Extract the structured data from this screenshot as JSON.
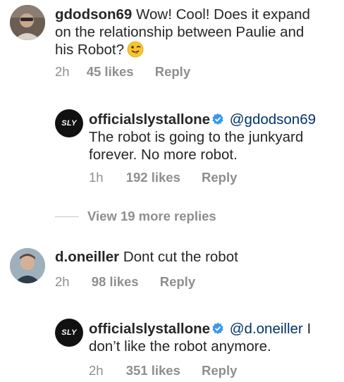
{
  "comments": [
    {
      "username": "gdodson69",
      "text_lines": [
        "Wow!  Cool!  Does it expand",
        "on the relationship between Paulie and",
        "his Robot?"
      ],
      "emoji": "winking-tongue-emoji",
      "time": "2h",
      "likes": "45 likes",
      "reply": "Reply"
    },
    {
      "username": "officialslystallone",
      "verified": true,
      "avatar_text": "SLY",
      "mention": "@gdodson69",
      "text_lines": [
        "The robot is going to the junkyard",
        "forever. No more robot."
      ],
      "time": "1h",
      "likes": "192 likes",
      "reply": "Reply"
    },
    {
      "username": "d.oneiller",
      "text": "Dont cut the robot",
      "time": "2h",
      "likes": "98 likes",
      "reply": "Reply"
    },
    {
      "username": "officialslystallone",
      "verified": true,
      "avatar_text": "SLY",
      "mention": "@d.oneiller",
      "text_after_mention": " I",
      "text_line2": "don’t like the robot anymore.",
      "time": "2h",
      "likes": "351 likes",
      "reply": "Reply"
    }
  ],
  "view_more_replies": "View 19 more replies",
  "colors": {
    "text": "#262626",
    "muted": "#8e8e8e",
    "mention": "#003569",
    "verified": "#3897f0",
    "sly_avatar": "#111111"
  }
}
